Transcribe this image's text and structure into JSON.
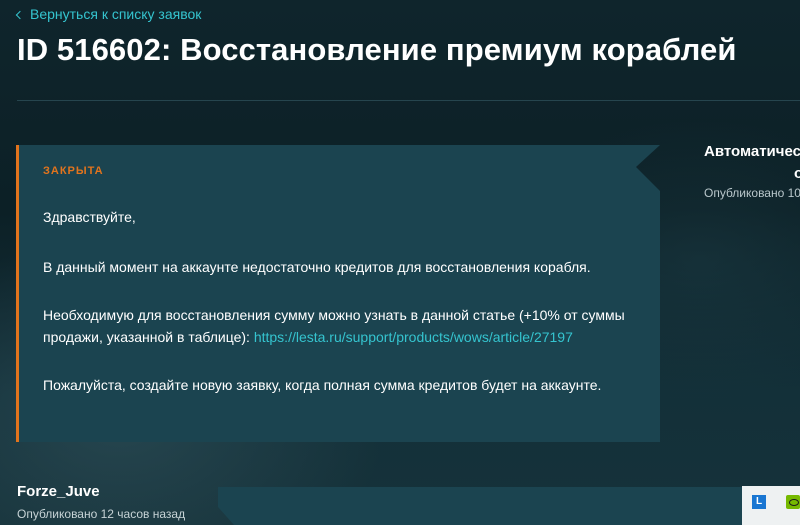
{
  "nav": {
    "back_link": "Вернуться к списку заявок"
  },
  "ticket": {
    "title": "ID 516602: Восстановление премиум кораблей",
    "status": "ЗАКРЫТА"
  },
  "message": {
    "greeting": "Здравствуйте,",
    "line1": "В данный момент на аккаунте недостаточно кредитов для восстановления корабля.",
    "line2a": "Необходимую для восстановления сумму можно узнать в данной статье (+10% от суммы",
    "line2b": "продажи, указанной в таблице): ",
    "link": "https://lesta.ru/support/products/wows/article/27197",
    "line3": "Пожалуйста, создайте новую заявку, когда полная сумма кредитов будет на аккаунте."
  },
  "reply_author": {
    "name_line1": "Автоматичес",
    "name_line2": "отв",
    "published": "Опубликовано 10"
  },
  "comment": {
    "author": "Forze_Juve",
    "published": "Опубликовано 12 часов назад"
  },
  "tray": {
    "icon1_label": "L",
    "icon1": "lang-indicator-icon",
    "icon2": "nvidia-icon"
  },
  "colors": {
    "accent": "#35c4cf",
    "status": "#e2741d",
    "card_bg": "#1b4450",
    "page_bg": "#0d2229"
  }
}
